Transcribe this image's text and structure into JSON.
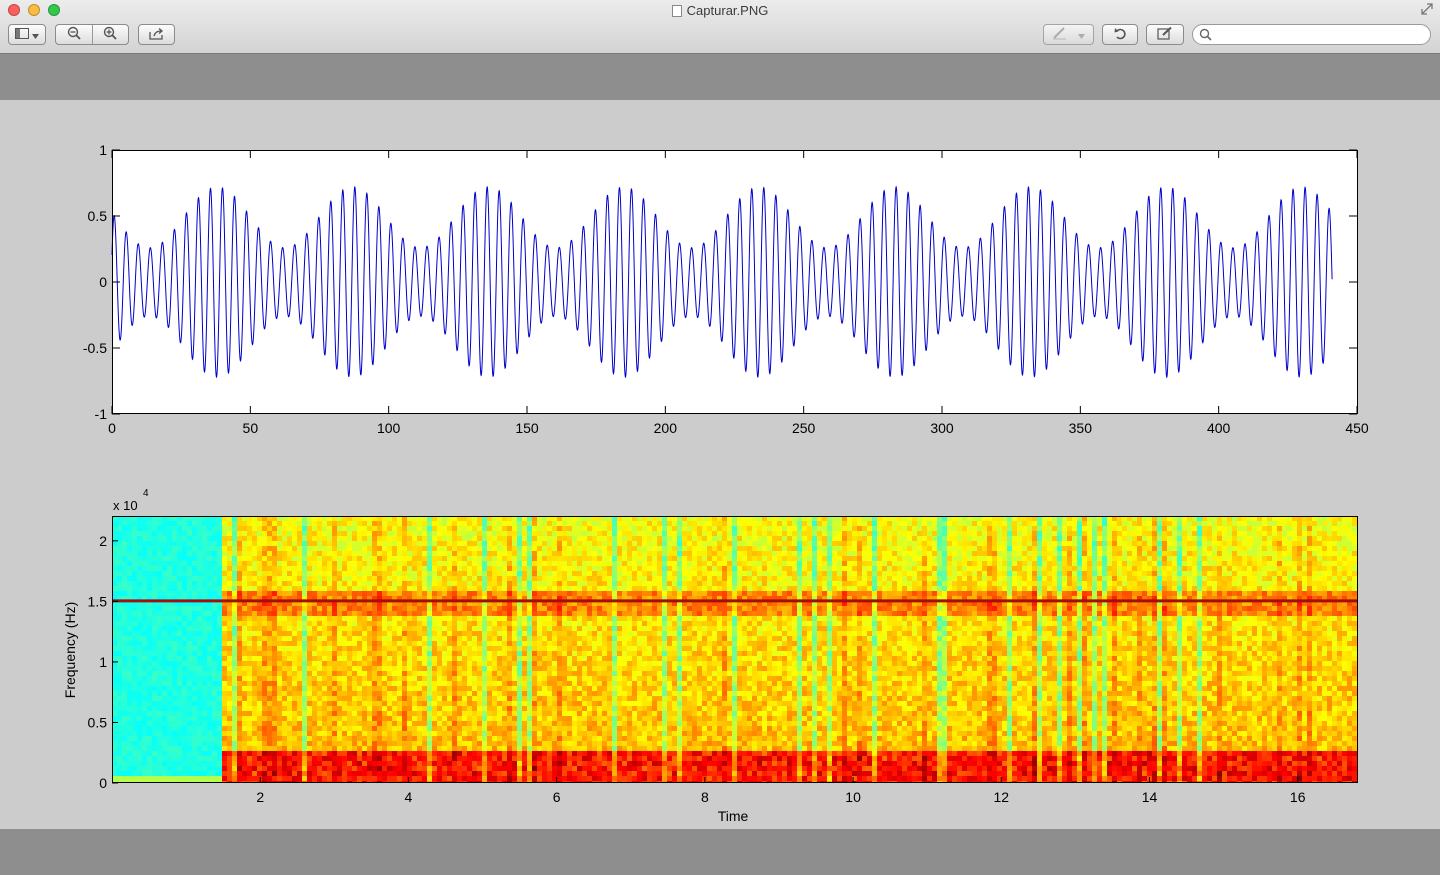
{
  "window": {
    "title": "Capturar.PNG",
    "traffic_colors": [
      "#fc605c",
      "#fdbc40",
      "#34c84a"
    ]
  },
  "toolbar": {
    "icons": [
      "sidebar-icon",
      "chevron-down-icon",
      "zoom-out-icon",
      "zoom-in-icon",
      "share-icon",
      "annotate-icon",
      "rotate-icon",
      "edit-icon",
      "search-icon",
      "fullscreen-icon"
    ],
    "search_placeholder": ""
  },
  "chart_data": [
    {
      "type": "line",
      "title": "",
      "xlabel": "",
      "ylabel": "",
      "xlim": [
        0,
        450
      ],
      "ylim": [
        -1,
        1
      ],
      "x_ticks": [
        "0",
        "50",
        "100",
        "150",
        "200",
        "250",
        "300",
        "350",
        "400",
        "450"
      ],
      "y_ticks": [
        "1",
        "0.5",
        "0",
        "-0.5",
        "-1"
      ],
      "series": [
        {
          "color": "#0000cc",
          "x_range": [
            0,
            441
          ],
          "signal": "carrier amplitude-modulated by a slow sinusoid",
          "envelope_max": 0.72,
          "envelope_min": 0.26,
          "envelope_period": 49,
          "first_envelope_peak_x": 38,
          "carrier_cycles_per_unit": 0.23
        }
      ],
      "grid": false
    },
    {
      "type": "heatmap",
      "title": "",
      "xlabel": "Time",
      "ylabel": "Frequency (Hz)",
      "y_exponent_label": "x 10",
      "y_exponent": "4",
      "xlim": [
        0,
        16.8
      ],
      "ylim": [
        0,
        22050
      ],
      "x_ticks": [
        "2",
        "4",
        "6",
        "8",
        "10",
        "12",
        "14",
        "16"
      ],
      "y_ticks": [
        "2",
        "1.5",
        "1",
        "0.5",
        "0"
      ],
      "colormap": "jet",
      "quiet_segment_time": [
        0,
        1.5
      ],
      "tone_frequency_hz": 15000,
      "colors": {
        "quiet": "#2ee0d0",
        "loud": "#f5e60c",
        "peak": "#ee4412",
        "tone": "#a01010"
      }
    }
  ]
}
